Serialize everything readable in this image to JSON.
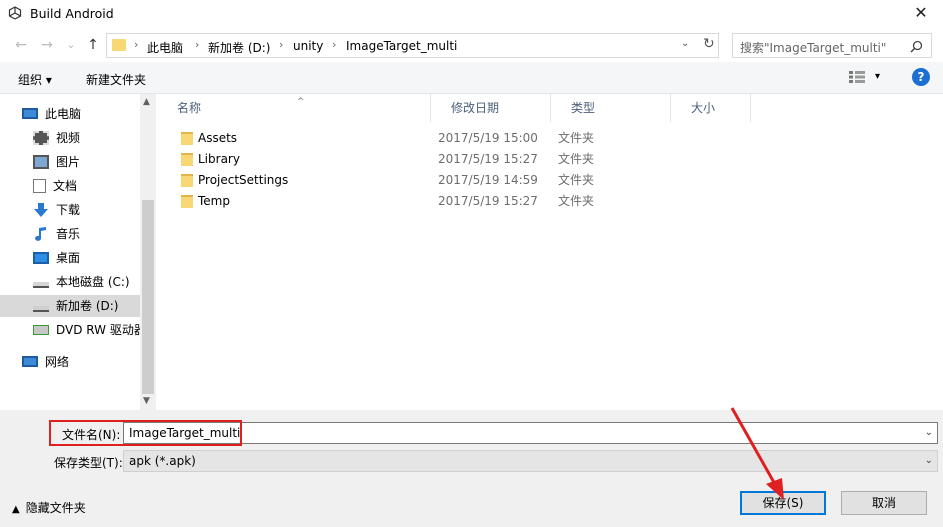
{
  "window": {
    "title": "Build Android",
    "close_glyph": "✕"
  },
  "nav": {
    "back_glyph": "←",
    "forward_glyph": "→",
    "recent_glyph": "⌄",
    "up_glyph": "↑",
    "breadcrumb": [
      "此电脑",
      "新加卷 (D:)",
      "unity",
      "ImageTarget_multi"
    ],
    "separator": "›",
    "dropdown_glyph": "⌄",
    "refresh_glyph": "↻",
    "search_placeholder": "搜索\"ImageTarget_multi\"",
    "search_icon": "search-icon"
  },
  "toolbar": {
    "organize": "组织 ▾",
    "new_folder": "新建文件夹",
    "view_dd": "▾",
    "help": "?"
  },
  "sidebar": {
    "items": [
      {
        "label": "此电脑",
        "icon": "computer-icon"
      },
      {
        "label": "视频",
        "icon": "video-icon"
      },
      {
        "label": "图片",
        "icon": "picture-icon"
      },
      {
        "label": "文档",
        "icon": "document-icon"
      },
      {
        "label": "下载",
        "icon": "download-icon"
      },
      {
        "label": "音乐",
        "icon": "music-icon"
      },
      {
        "label": "桌面",
        "icon": "desktop-icon"
      },
      {
        "label": "本地磁盘 (C:)",
        "icon": "drive-c-icon"
      },
      {
        "label": "新加卷 (D:)",
        "icon": "drive-d-icon"
      },
      {
        "label": "DVD RW 驱动器",
        "icon": "dvd-icon"
      },
      {
        "label": "网络",
        "icon": "network-icon"
      }
    ],
    "selected_index": 8,
    "scroll_up": "▲",
    "scroll_down": "▼"
  },
  "columns": {
    "name": "名称",
    "modified": "修改日期",
    "type": "类型",
    "size": "大小",
    "sort_glyph": "^"
  },
  "files": [
    {
      "name": "Assets",
      "date": "2017/5/19 15:00",
      "type": "文件夹"
    },
    {
      "name": "Library",
      "date": "2017/5/19 15:27",
      "type": "文件夹"
    },
    {
      "name": "ProjectSettings",
      "date": "2017/5/19 14:59",
      "type": "文件夹"
    },
    {
      "name": "Temp",
      "date": "2017/5/19 15:27",
      "type": "文件夹"
    }
  ],
  "save": {
    "filename_label": "文件名(N):",
    "filename_value": "ImageTarget_multi",
    "filetype_label": "保存类型(T):",
    "filetype_value": "apk (*.apk)",
    "dropdown_glyph": "⌄",
    "hide_folders": "隐藏文件夹",
    "hide_chev": "▲",
    "save_button": "保存(S)",
    "cancel_button": "取消"
  },
  "colors": {
    "accent": "#0078d7",
    "highlight": "#e02020",
    "folder": "#f8d775"
  }
}
